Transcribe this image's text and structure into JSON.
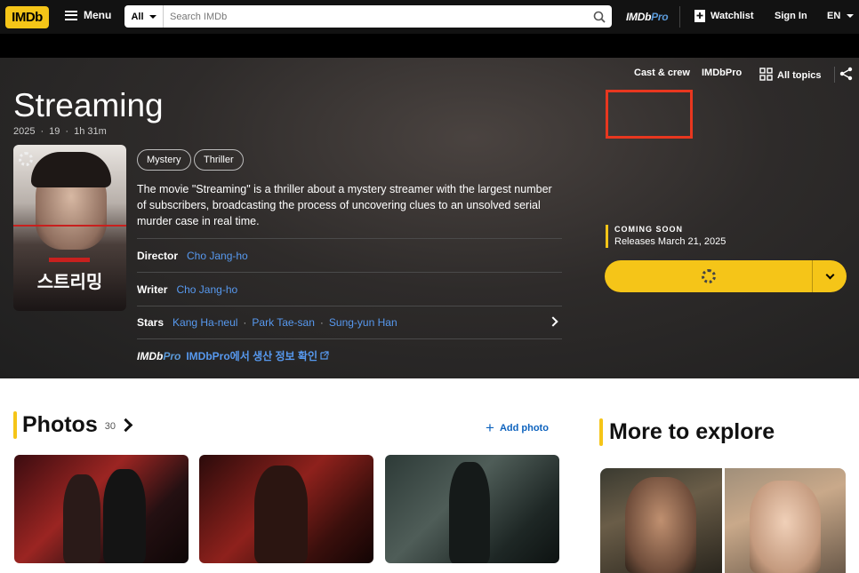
{
  "nav": {
    "logo": "IMDb",
    "menu": "Menu",
    "search_category": "All",
    "search_placeholder": "Search IMDb",
    "imdbpro_a": "IMDb",
    "imdbpro_b": "Pro",
    "watchlist": "Watchlist",
    "signin": "Sign In",
    "lang": "EN"
  },
  "hero": {
    "links": [
      "Cast & crew",
      "IMDbPro",
      "All topics"
    ],
    "title": "Streaming",
    "year": "2025",
    "rating": "19",
    "runtime": "1h 31m",
    "genres": [
      "Mystery",
      "Thriller"
    ],
    "plot": "The movie \"Streaming\" is a thriller about a mystery streamer with the largest number of subscribers, broadcasting the process of uncovering clues to an unsolved serial murder case in real time.",
    "director_label": "Director",
    "director": "Cho Jang-ho",
    "writer_label": "Writer",
    "writer": "Cho Jang-ho",
    "stars_label": "Stars",
    "stars": [
      "Kang Ha-neul",
      "Park Tae-san",
      "Sung-yun Han"
    ],
    "pro_a": "IMDb",
    "pro_b": "Pro",
    "pro_link": "IMDbPro에서 생산 정보 확인",
    "poster_title": "스트리밍",
    "coming_label": "COMING SOON",
    "release": "Releases March 21, 2025"
  },
  "photos": {
    "title": "Photos",
    "count": "30",
    "add": "Add photo"
  },
  "explore": {
    "title": "More to explore"
  },
  "colors": {
    "accent": "#f5c518",
    "link": "#5799ef",
    "highlight_box": "#e8371f"
  }
}
